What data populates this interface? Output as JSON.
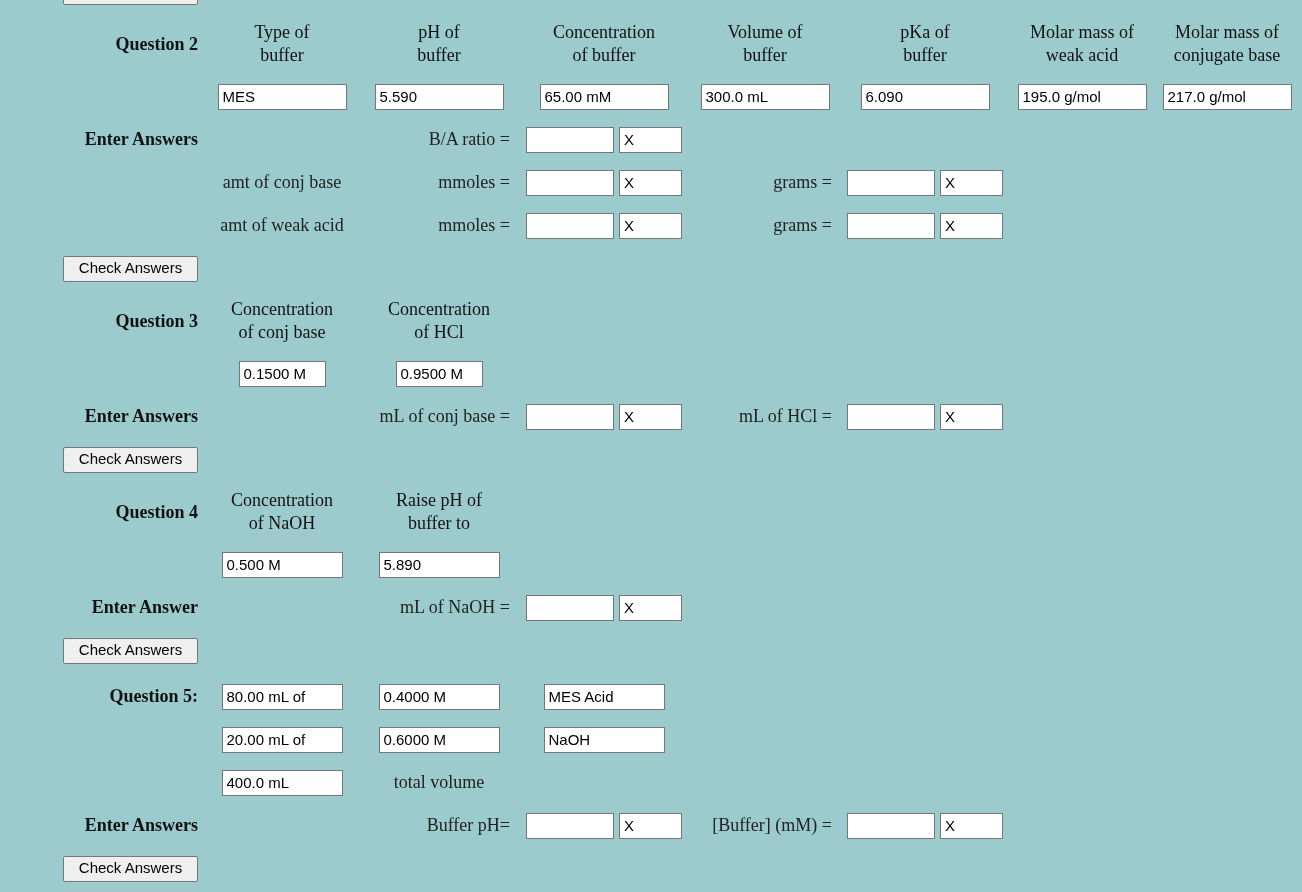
{
  "sections": [
    {
      "rows": [
        {
          "kind": "header",
          "label": "Question 2",
          "cells": [
            {
              "kind": "heading",
              "text": "Type of\nbuffer"
            },
            {
              "kind": "heading",
              "text": "pH of\nbuffer"
            },
            {
              "kind": "heading",
              "text": "Concentration\nof buffer"
            },
            {
              "kind": "heading",
              "text": "Volume of\nbuffer"
            },
            {
              "kind": "heading",
              "text": "pKa of\nbuffer"
            },
            {
              "kind": "heading",
              "text": "Molar mass of\nweak acid"
            },
            {
              "kind": "heading",
              "text": "Molar mass of\nconjugate base"
            }
          ]
        },
        {
          "kind": "plain",
          "cells": [
            {
              "kind": "field",
              "value": "MES"
            },
            {
              "kind": "field",
              "value": "5.590"
            },
            {
              "kind": "field",
              "value": "65.00 mM"
            },
            {
              "kind": "field",
              "value": "300.0 mL"
            },
            {
              "kind": "field",
              "value": "6.090"
            },
            {
              "kind": "field",
              "value": "195.0 g/mol"
            },
            {
              "kind": "field",
              "value": "217.0 g/mol"
            }
          ]
        },
        {
          "kind": "plain",
          "label": "Enter Answers",
          "cells": [
            {
              "kind": "blank"
            },
            {
              "kind": "prompt",
              "text": "B/A ratio ="
            },
            {
              "kind": "answer",
              "mark": "X"
            }
          ]
        },
        {
          "kind": "plain",
          "cells": [
            {
              "kind": "text",
              "text": "amt of conj base"
            },
            {
              "kind": "prompt",
              "text": "mmoles ="
            },
            {
              "kind": "answer",
              "mark": "X"
            },
            {
              "kind": "prompt",
              "text": "grams ="
            },
            {
              "kind": "answer",
              "mark": "X"
            }
          ]
        },
        {
          "kind": "plain",
          "cells": [
            {
              "kind": "text",
              "text": "amt of weak acid"
            },
            {
              "kind": "prompt",
              "text": "mmoles ="
            },
            {
              "kind": "answer",
              "mark": "X"
            },
            {
              "kind": "prompt",
              "text": "grams ="
            },
            {
              "kind": "answer",
              "mark": "X"
            }
          ]
        },
        {
          "kind": "button",
          "label": "Check Answers"
        }
      ]
    },
    {
      "rows": [
        {
          "kind": "header",
          "label": "Question 3",
          "cells": [
            {
              "kind": "heading",
              "text": "Concentration\nof conj base"
            },
            {
              "kind": "heading",
              "text": "Concentration\nof HCl"
            }
          ]
        },
        {
          "kind": "plain",
          "cells": [
            {
              "kind": "field",
              "value": "0.1500 M"
            },
            {
              "kind": "field",
              "value": "0.9500 M"
            }
          ]
        },
        {
          "kind": "plain",
          "label": "Enter Answers",
          "cells": [
            {
              "kind": "blank"
            },
            {
              "kind": "prompt",
              "text": "mL of conj base ="
            },
            {
              "kind": "answer",
              "mark": "X"
            },
            {
              "kind": "prompt",
              "text": "mL of HCl ="
            },
            {
              "kind": "answer",
              "mark": "X"
            }
          ]
        },
        {
          "kind": "button",
          "label": "Check Answers"
        }
      ]
    },
    {
      "rows": [
        {
          "kind": "header",
          "label": "Question 4",
          "cells": [
            {
              "kind": "heading",
              "text": "Concentration\nof NaOH"
            },
            {
              "kind": "heading",
              "text": "Raise pH of\nbuffer to"
            }
          ]
        },
        {
          "kind": "plain",
          "cells": [
            {
              "kind": "field",
              "value": "0.500 M"
            },
            {
              "kind": "field",
              "value": "5.890"
            }
          ]
        },
        {
          "kind": "plain",
          "label": "Enter Answer",
          "cells": [
            {
              "kind": "blank"
            },
            {
              "kind": "prompt",
              "text": "mL of NaOH ="
            },
            {
              "kind": "answer",
              "mark": "X"
            }
          ]
        },
        {
          "kind": "button",
          "label": "Check Answers"
        }
      ]
    },
    {
      "rows": [
        {
          "kind": "plain",
          "label": "Question 5:",
          "cells": [
            {
              "kind": "field",
              "value": "80.00 mL of"
            },
            {
              "kind": "field",
              "value": "0.4000 M"
            },
            {
              "kind": "field",
              "value": "MES Acid"
            }
          ]
        },
        {
          "kind": "plain",
          "cells": [
            {
              "kind": "field",
              "value": "20.00 mL of"
            },
            {
              "kind": "field",
              "value": "0.6000 M"
            },
            {
              "kind": "field",
              "value": "NaOH"
            }
          ]
        },
        {
          "kind": "plain",
          "cells": [
            {
              "kind": "field",
              "value": "400.0 mL"
            },
            {
              "kind": "text",
              "text": "total volume"
            }
          ]
        },
        {
          "kind": "plain",
          "label": "Enter Answers",
          "cells": [
            {
              "kind": "blank"
            },
            {
              "kind": "prompt",
              "text": "Buffer pH="
            },
            {
              "kind": "answer",
              "mark": "X"
            },
            {
              "kind": "prompt",
              "text": "[Buffer] (mM) ="
            },
            {
              "kind": "answer",
              "mark": "X"
            }
          ]
        },
        {
          "kind": "button",
          "label": "Check Answers"
        }
      ]
    }
  ]
}
